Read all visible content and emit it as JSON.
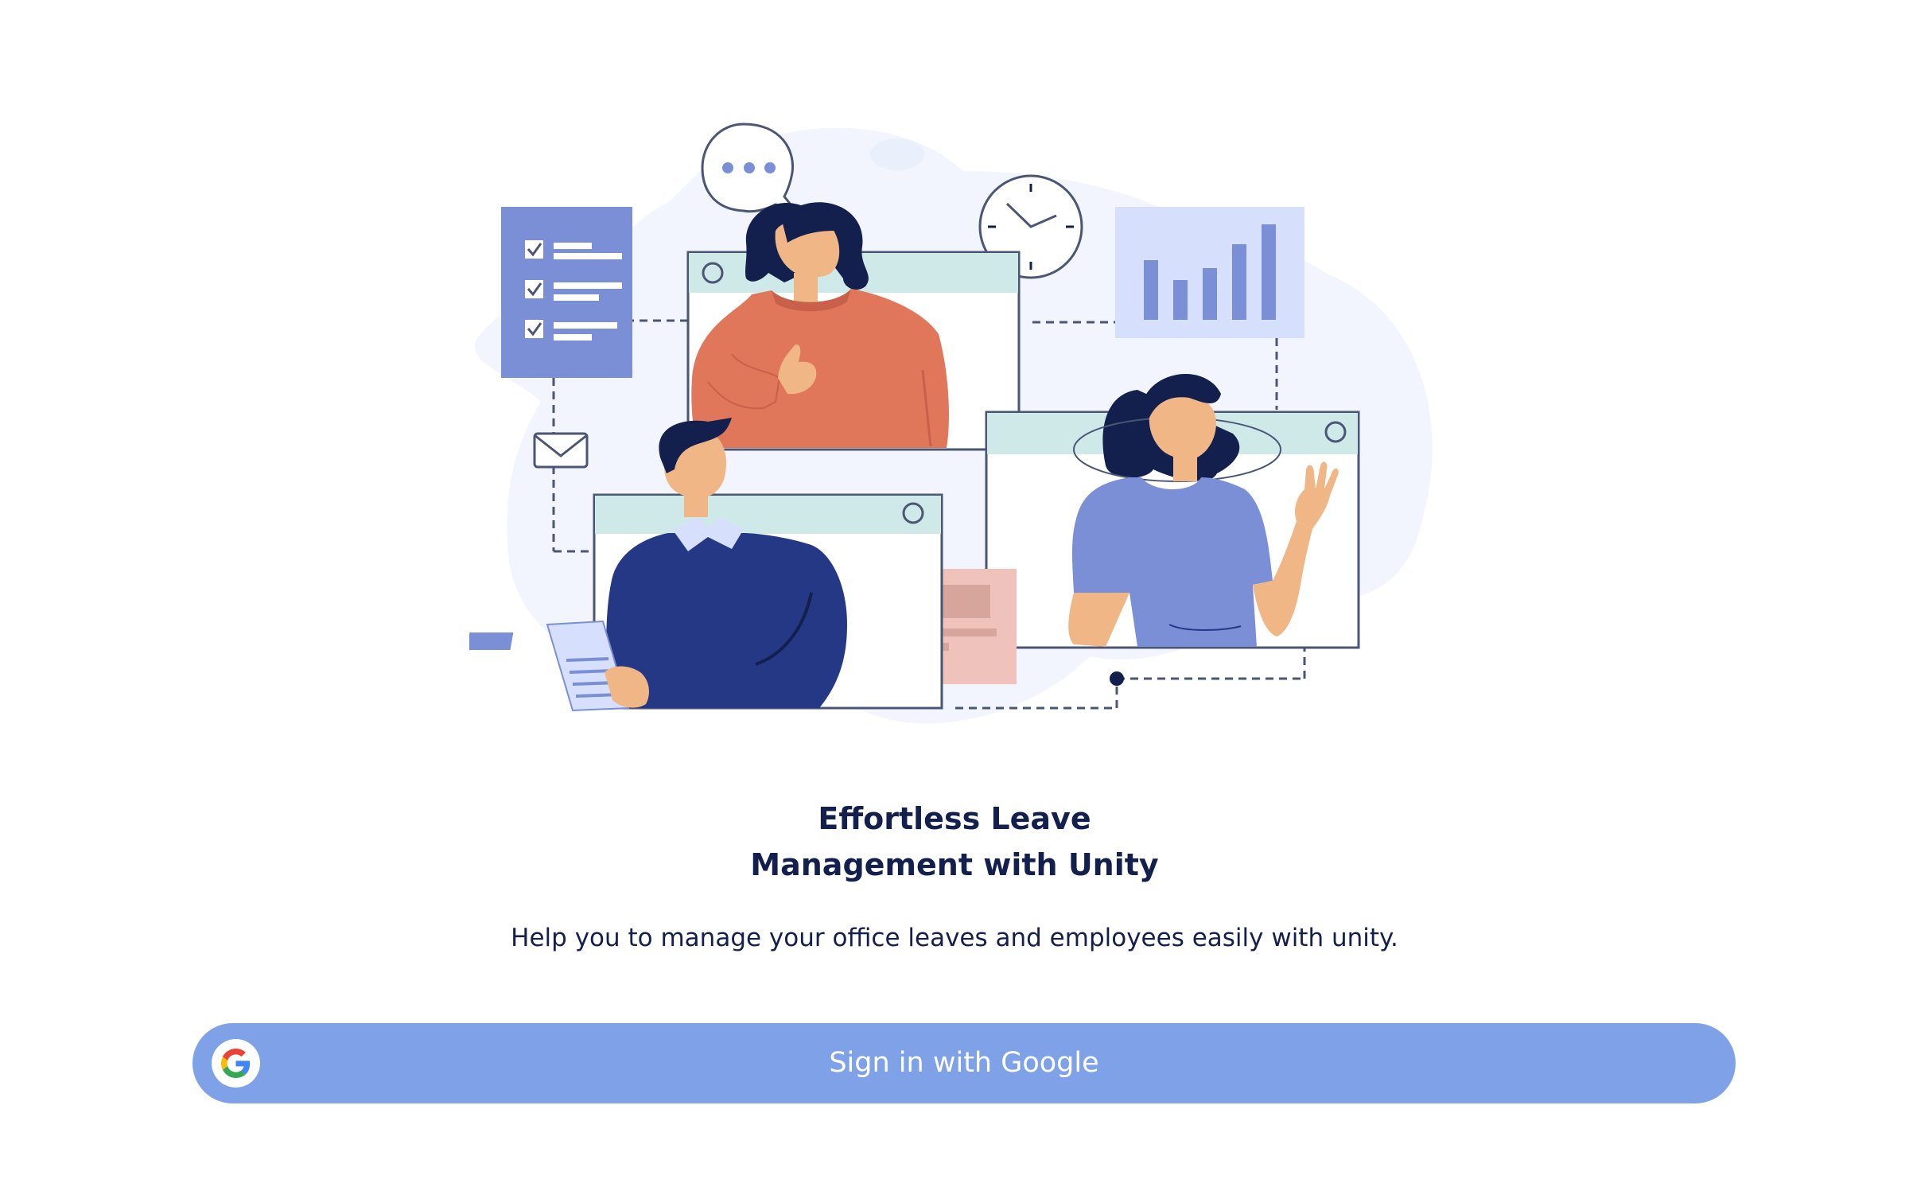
{
  "hero": {
    "title_line1": "Effortless Leave",
    "title_line2": "Management with Unity",
    "subtitle": "Help you to manage your office leaves and employees easily with unity."
  },
  "illustration": {
    "icon": "team-collaboration-illustration"
  },
  "signin": {
    "label": "Sign in with Google",
    "icon": "google-icon"
  },
  "colors": {
    "heading": "#13204e",
    "button": "#7fa1e8",
    "button_text": "#ffffff",
    "illustration_blue": "#7b8fd6",
    "illustration_navy": "#253886",
    "illustration_orange": "#e0775b"
  }
}
